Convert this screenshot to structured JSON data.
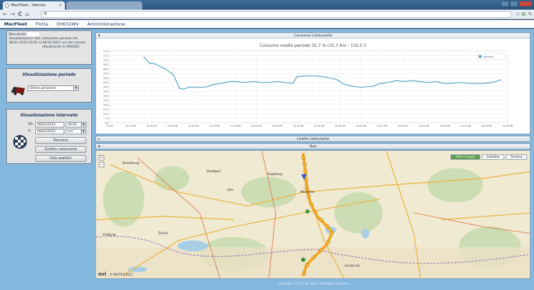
{
  "browser": {
    "tabs": [
      {
        "label": "MecFleet - Vehicle"
      },
      {
        "label": ""
      }
    ],
    "nav": {
      "back": "←",
      "forward": "→",
      "reload": "C",
      "home": "⌂",
      "favicon": "◉"
    },
    "url": "",
    "right_icons": {
      "star": "☆",
      "ext": "⧉",
      "wrench": "✎"
    }
  },
  "app_menu": {
    "brand": "MecFleet",
    "items": [
      "Flotta",
      "EH631WV",
      "Amministrazione"
    ]
  },
  "sidebar": {
    "welcome": {
      "greeting": "Benvenuto",
      "line1": "Visualizzazione dati carburante periodo dal",
      "line2": "08-02-2012 00:02 al 08-03-2012 ora del veicolo",
      "line3": "attualmente in 9402ZO"
    },
    "period": {
      "title": "Visualizzazione periodo",
      "select_value": "Ultima posizione"
    },
    "interval": {
      "title": "Visualizzazione intervallo",
      "from_label": "Da",
      "to_label": "A",
      "from_date": "08/03/2012",
      "from_time": "00:02",
      "to_date": "08/03/2012",
      "to_time": "ora",
      "buttons": [
        "Percorso",
        "Grafico carburante",
        "Dati analitici"
      ]
    }
  },
  "chart_panel": {
    "title": "Consumo Carburante",
    "subtitle": "Consumo medio periodo 35,7 % (35,7 Km - 110,5 l)"
  },
  "chart_data": {
    "type": "line",
    "ylim": [
      0,
      75
    ],
    "yticks": [
      "75,0",
      "72,5",
      "70,0",
      "65,0",
      "60,0",
      "55,0",
      "50,0",
      "45,0",
      "40,0",
      "35,0",
      "30,0",
      "25,0",
      "20,0",
      "15,0",
      "10,0",
      "5,0",
      "0,0"
    ],
    "xticks": [
      "00:00",
      "00:15 PM",
      "00:30 PM",
      "00:45 PM",
      "01:00 PM",
      "01:15 PM",
      "01:30 PM",
      "01:45 PM",
      "02:00 PM",
      "02:15 PM",
      "02:30 PM",
      "02:45 PM",
      "03:00 PM",
      "03:15 PM",
      "03:30 PM",
      "03:45 PM",
      "04:00 PM",
      "04:15 PM",
      "04:30 PM",
      "04:45 PM"
    ],
    "legend": "consumo",
    "color": "#5aa3c7",
    "series": [
      {
        "name": "consumo",
        "x": [
          0.085,
          0.1,
          0.11,
          0.14,
          0.16,
          0.175,
          0.185,
          0.2,
          0.22,
          0.24,
          0.26,
          0.28,
          0.3,
          0.32,
          0.34,
          0.36,
          0.38,
          0.4,
          0.42,
          0.44,
          0.46,
          0.47,
          0.49,
          0.52,
          0.55,
          0.57,
          0.59,
          0.61,
          0.63,
          0.66,
          0.68,
          0.7,
          0.72,
          0.74,
          0.76,
          0.78,
          0.8,
          0.82,
          0.84,
          0.86,
          0.88,
          0.9,
          0.92,
          0.94,
          0.96,
          0.985
        ],
        "values": [
          69,
          62,
          62,
          56,
          50,
          36,
          35,
          37,
          37,
          37,
          40,
          41,
          43,
          43,
          42,
          43,
          42,
          42,
          43,
          42,
          41,
          48,
          49,
          49,
          47,
          45,
          40,
          38,
          37,
          38,
          41,
          42,
          44,
          43,
          44,
          43,
          42,
          43,
          41,
          41,
          42,
          41,
          41,
          41,
          42,
          45
        ]
      }
    ]
  },
  "panels": {
    "livello": "Livello carburante",
    "test": "Test"
  },
  "map": {
    "tabs": [
      "Vista mappa",
      "Satellite",
      "Terreno"
    ],
    "cities": [
      "Strasbourg",
      "Stuttgart",
      "Augsburg",
      "München",
      "Freiburg",
      "Zürich",
      "Innsbruck",
      "Ulm"
    ],
    "attribution": "© NAVTEQ 2012",
    "logo": "ovi",
    "zoom_in": "+",
    "zoom_out": "−"
  },
  "footer": "Copyright © 2012 by Tramo, All Rights Reserved"
}
